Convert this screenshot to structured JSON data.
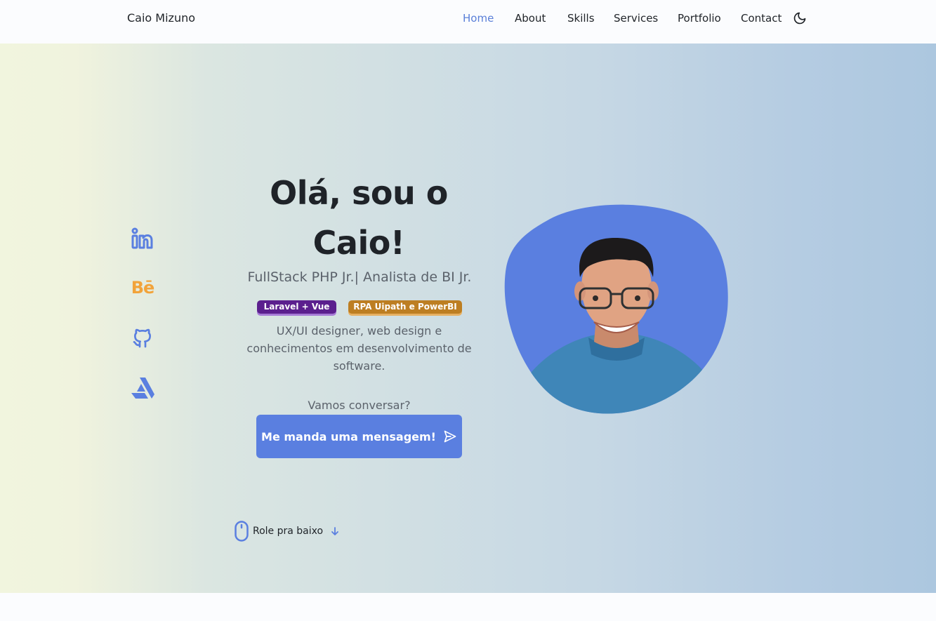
{
  "header": {
    "logo": "Caio Mizuno",
    "nav": [
      {
        "label": "Home",
        "active": true
      },
      {
        "label": "About",
        "active": false
      },
      {
        "label": "Skills",
        "active": false
      },
      {
        "label": "Services",
        "active": false
      },
      {
        "label": "Portfolio",
        "active": false
      },
      {
        "label": "Contact",
        "active": false
      }
    ],
    "theme_icon": "moon-icon"
  },
  "social": [
    {
      "name": "linkedin-icon",
      "color": "#5a7fe0"
    },
    {
      "name": "behance-icon",
      "label": "Bē",
      "color": "#f2a33a"
    },
    {
      "name": "github-icon",
      "color": "#5a7fe0"
    },
    {
      "name": "artstation-icon",
      "color": "#5a7fe0"
    }
  ],
  "hero": {
    "title_line1": "Olá, sou o",
    "title_line2": "Caio!",
    "subtitle": "FullStack PHP Jr.| Analista de BI Jr.",
    "badges": [
      "Laravel + Vue",
      "RPA Uipath e PowerBI"
    ],
    "description": "UX/UI designer, web design e conhecimentos em desenvolvimento de software.",
    "cta_label": "Vamos conversar?",
    "cta_button": "Me manda uma mensagem!",
    "scroll_hint": "Role pra baixo"
  },
  "colors": {
    "accent": "#5a7fe0",
    "laravel_badge": "#5b1f8e",
    "rpa_badge": "#bd7e22",
    "behance": "#f2a33a"
  }
}
